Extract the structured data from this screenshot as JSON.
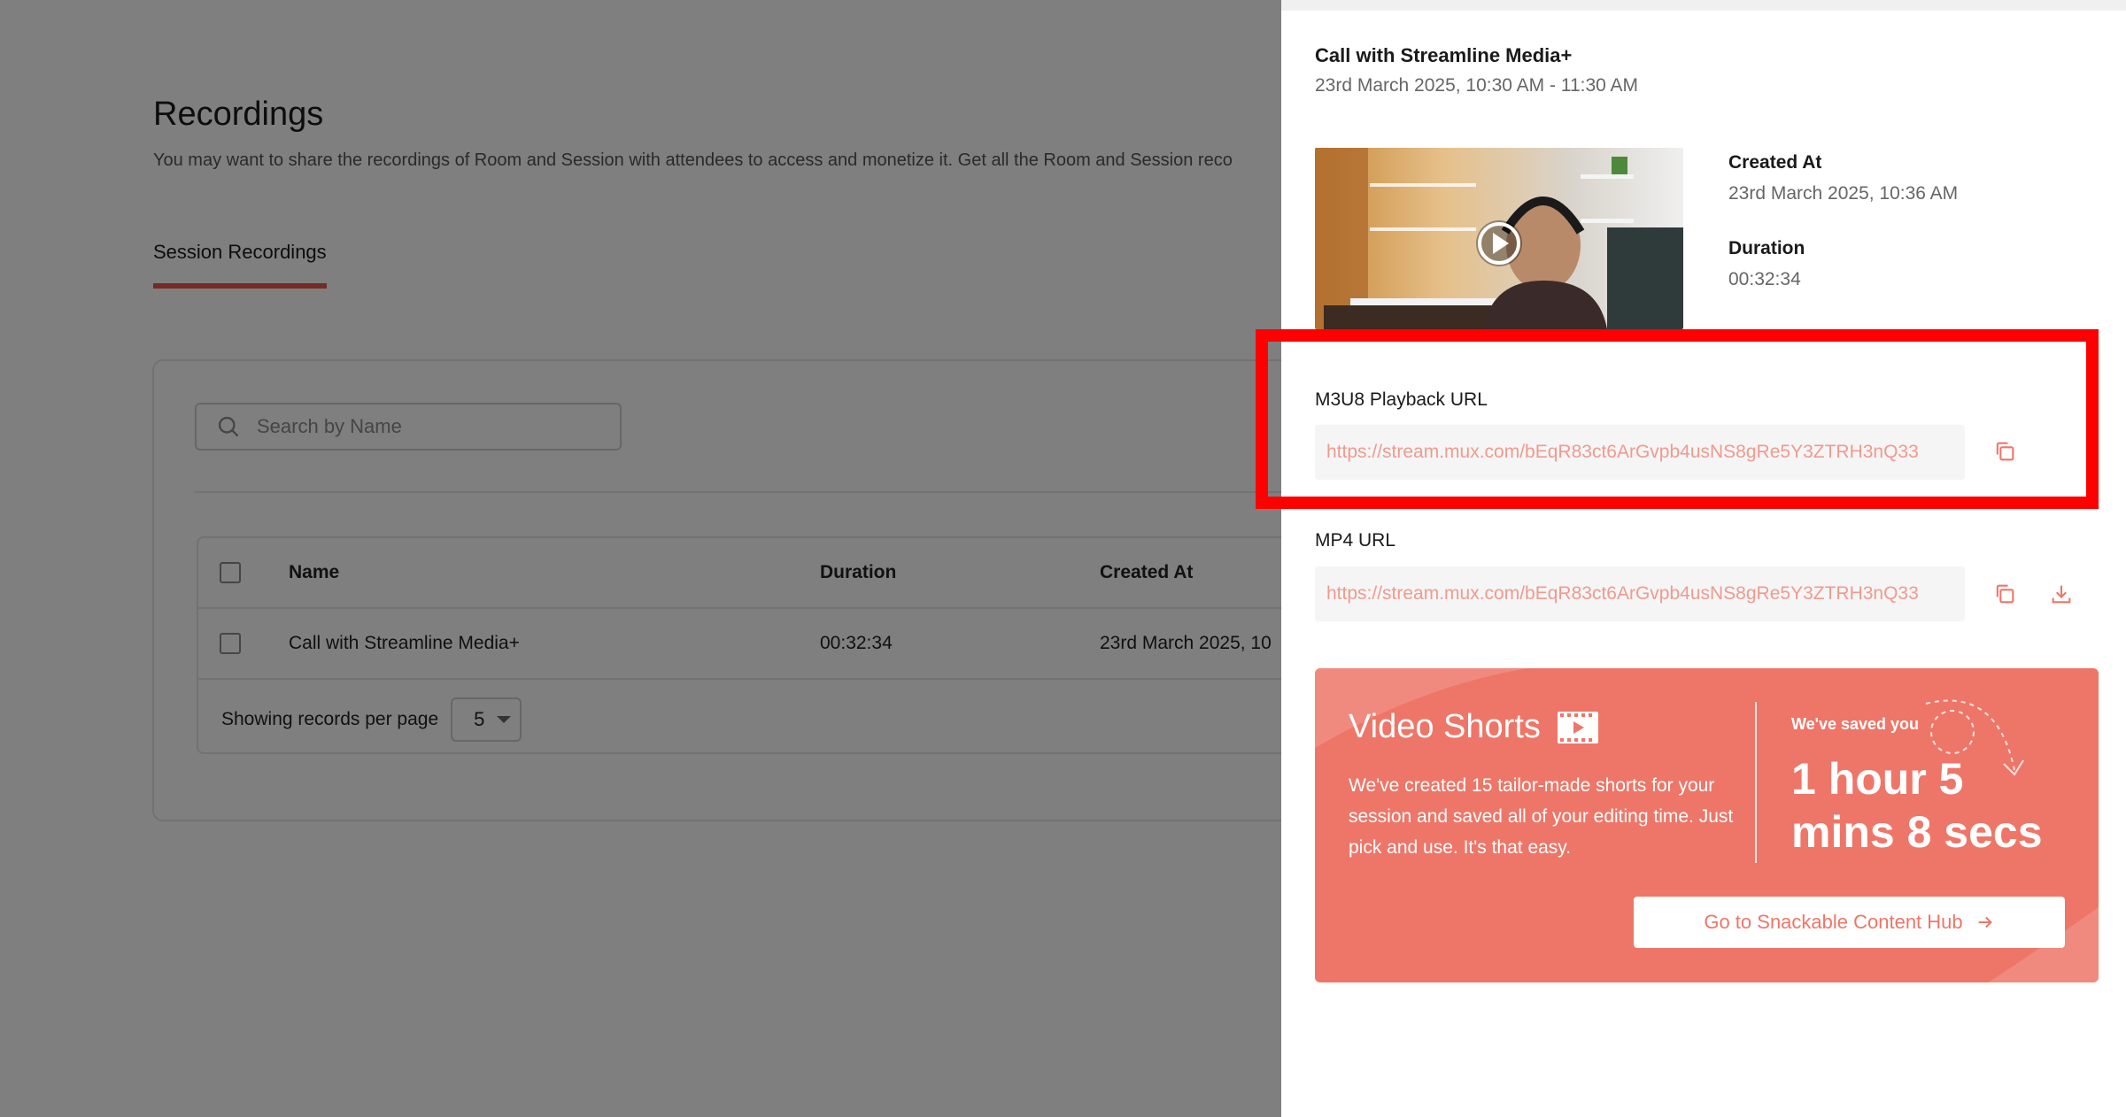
{
  "page": {
    "title": "Recordings",
    "description": "You may want to share the recordings of Room and Session with attendees to access and monetize it. Get all the Room and Session reco",
    "tab": "Session Recordings",
    "search_placeholder": "Search by Name",
    "table": {
      "headers": {
        "name": "Name",
        "duration": "Duration",
        "created_at": "Created At"
      },
      "rows": [
        {
          "name": "Call with Streamline Media+",
          "duration": "00:32:34",
          "created_at": "23rd March 2025, 10"
        }
      ]
    },
    "pager": {
      "label": "Showing records per page",
      "value": "5"
    }
  },
  "drawer": {
    "title": "Call with Streamline Media+",
    "time_range": "23rd March 2025, 10:30 AM - 11:30 AM",
    "created_at_label": "Created At",
    "created_at_value": "23rd March 2025, 10:36 AM",
    "duration_label": "Duration",
    "duration_value": "00:32:34",
    "m3u8": {
      "label": "M3U8 Playback URL",
      "url": "https://stream.mux.com/bEqR83ct6ArGvpb4usNS8gRe5Y3ZTRH3nQ33"
    },
    "mp4": {
      "label": "MP4 URL",
      "url": "https://stream.mux.com/bEqR83ct6ArGvpb4usNS8gRe5Y3ZTRH3nQ33"
    },
    "icons": {
      "copy": "copy-icon",
      "download": "download-icon",
      "play": "play-icon"
    },
    "promo": {
      "title": "Video Shorts",
      "text": "We've created 15 tailor-made shorts for your session and saved all of your editing time. Just pick and use. It's that easy.",
      "saved_label": "We've saved you",
      "saved_value": "1 hour 5 mins 8 secs",
      "button_label": "Go to Snackable Content Hub"
    }
  },
  "colors": {
    "accent": "#ee7668",
    "tab_underline": "#e8564a",
    "highlight": "#ff0000",
    "url_text": "#f09a8f"
  }
}
